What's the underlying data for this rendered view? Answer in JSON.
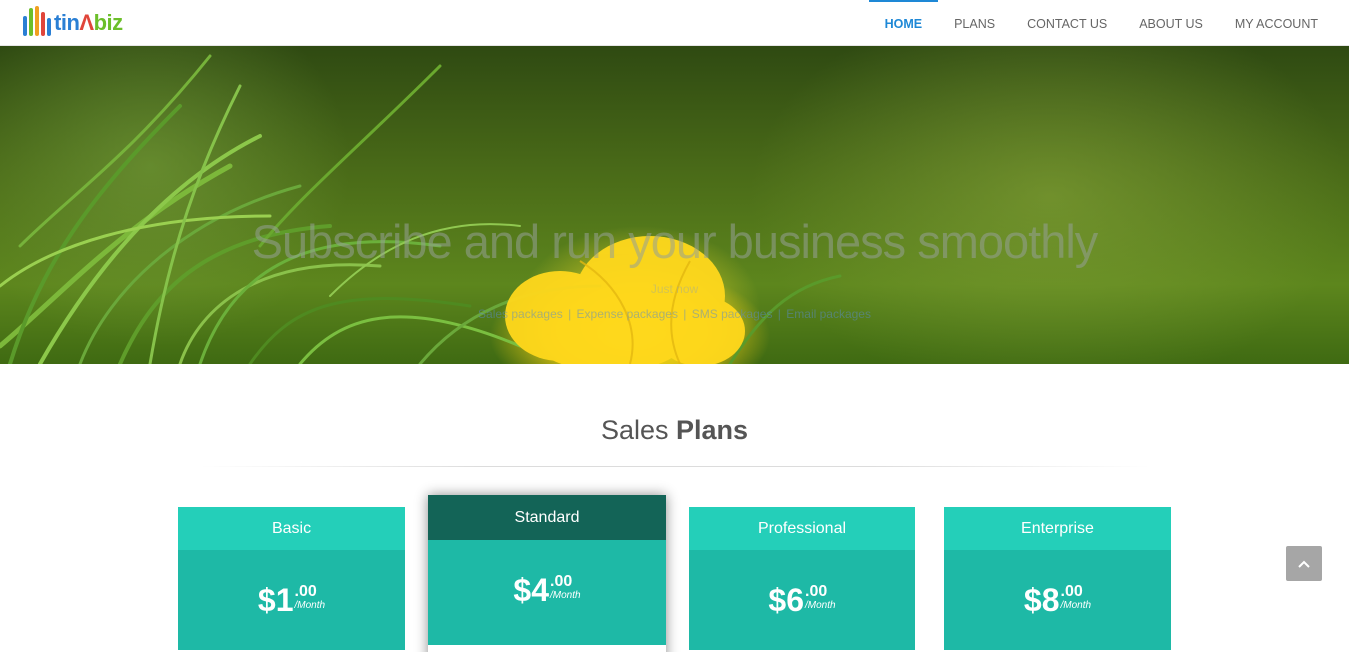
{
  "header": {
    "logo": {
      "text_main": "tin",
      "text_accent": "biz",
      "bar_colors": [
        "#2a7fd4",
        "#6cbf2a",
        "#f0a020",
        "#e0453a",
        "#2a7fd4"
      ]
    },
    "nav": [
      {
        "label": "HOME",
        "active": true
      },
      {
        "label": "PLANS",
        "active": false
      },
      {
        "label": "CONTACT US",
        "active": false
      },
      {
        "label": "ABOUT US",
        "active": false
      },
      {
        "label": "MY ACCOUNT",
        "active": false
      }
    ]
  },
  "hero": {
    "title": "Subscribe and run your business smoothly",
    "subtitle": "Just now",
    "links": [
      "Sales packages",
      "Expense packages",
      "SMS packages",
      "Email packages"
    ]
  },
  "plans_section": {
    "title_light": "Sales",
    "title_bold": "Plans",
    "plans": [
      {
        "name": "Basic",
        "price_whole": "$1",
        "price_cents": ".00",
        "period": "/Month"
      },
      {
        "name": "Standard",
        "price_whole": "$4",
        "price_cents": ".00",
        "period": "/Month",
        "featured": true
      },
      {
        "name": "Professional",
        "price_whole": "$6",
        "price_cents": ".00",
        "period": "/Month"
      },
      {
        "name": "Enterprise",
        "price_whole": "$8",
        "price_cents": ".00",
        "period": "/Month"
      }
    ]
  },
  "colors": {
    "accent": "#1e88d6",
    "plan_header": "#24cfb9",
    "plan_price": "#1eb9a6",
    "featured_header": "#136457"
  },
  "scroll_top": {
    "icon": "chevron-up-icon"
  }
}
